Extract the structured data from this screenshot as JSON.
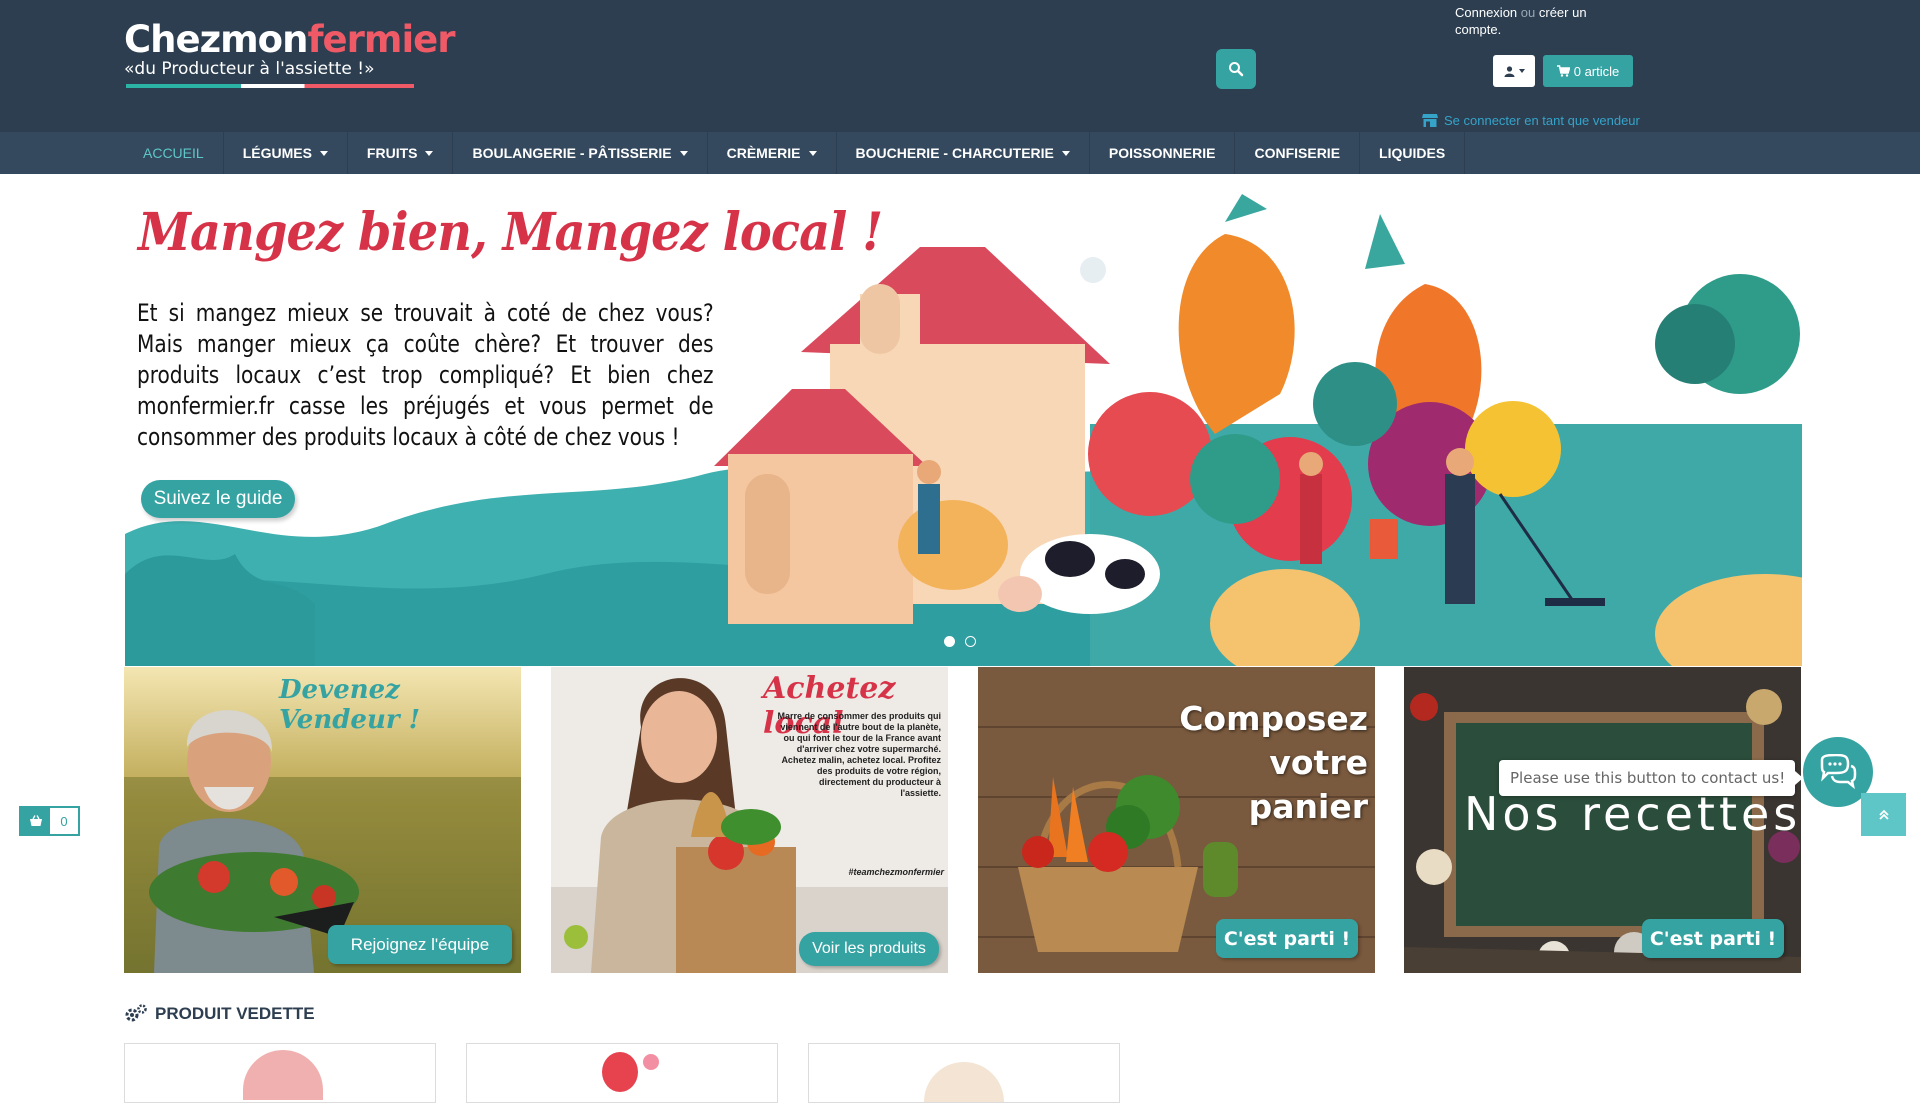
{
  "header": {
    "logo": {
      "part1": "Chezmon",
      "part2": "fermier",
      "tagline": "«du Producteur à l'assiette !»"
    },
    "account": {
      "login": "Connexion",
      "or": "ou",
      "create": "créer un compte."
    },
    "cart_label": "0 article",
    "vendor_link": "Se connecter en tant que vendeur"
  },
  "nav": {
    "items": [
      {
        "label": "ACCUEIL"
      },
      {
        "label": "LÉGUMES"
      },
      {
        "label": "FRUITS"
      },
      {
        "label": "BOULANGERIE - PÂTISSERIE"
      },
      {
        "label": "CRÈMERIE"
      },
      {
        "label": "BOUCHERIE - CHARCUTERIE"
      },
      {
        "label": "POISSONNERIE"
      },
      {
        "label": "CONFISERIE"
      },
      {
        "label": "LIQUIDES"
      }
    ]
  },
  "hero": {
    "title": "Mangez bien, Mangez local !",
    "text": "Et si mangez mieux se trouvait à coté de chez vous? Mais manger mieux ça coûte chère? Et trouver des produits locaux c’est trop compliqué? Et bien chez monfermier.fr casse les préjugés et vous permet de consommer des produits locaux à côté de chez vous !",
    "button": "Suivez le guide"
  },
  "promos": [
    {
      "title": "Devenez Vendeur !",
      "button": "Rejoignez l'équipe"
    },
    {
      "title": "Achetez local",
      "text": "Marre de consommer des produits qui viennent de l'autre bout de la planète, ou qui font le tour de la France avant d'arriver chez votre supermarché. Achetez malin, achetez local. Profitez des produits de votre région, directement du producteur à l'assiette.",
      "hashtag": "#teamchezmonfermier",
      "button": "Voir les produits"
    },
    {
      "title": "Composez votre panier",
      "button": "C'est parti !"
    },
    {
      "title": "Nos recettes",
      "button": "C'est parti !"
    }
  ],
  "featured": {
    "title": "PRODUIT VEDETTE"
  },
  "widgets": {
    "basket_count": "0",
    "chat_tooltip": "Please use this button to contact us!"
  },
  "colors": {
    "header_bg": "#2c3e50",
    "nav_bg": "#34495e",
    "accent": "#36a3a3",
    "brand_red": "#d63349"
  }
}
